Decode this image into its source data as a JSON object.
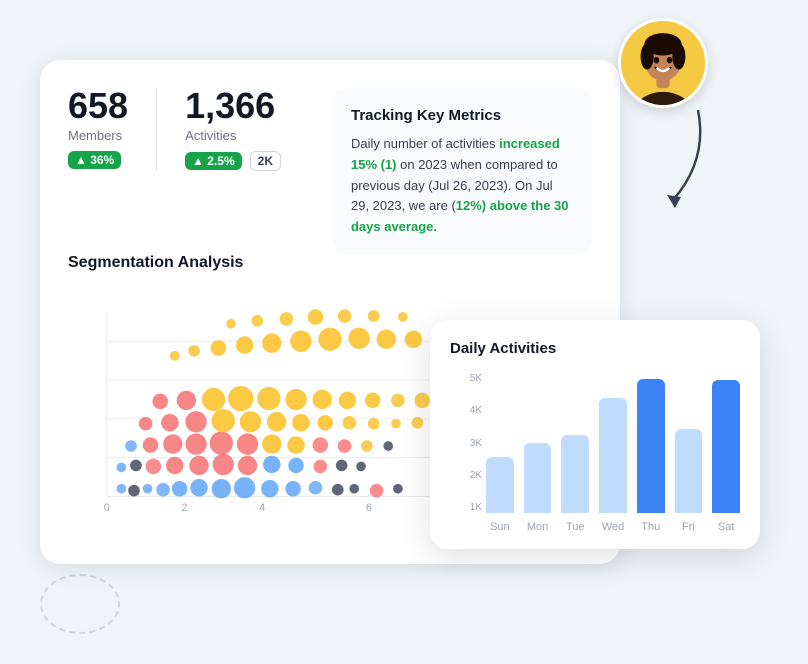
{
  "metrics": {
    "members": {
      "value": "658",
      "label": "Members",
      "badge": "▲ 36%"
    },
    "activities": {
      "value": "1,366",
      "label": "Activities",
      "badge": "▲ 2.5%",
      "badge2": "2K"
    }
  },
  "tracking": {
    "title": "Tracking Key Metrics",
    "text1": "Daily number of activities ",
    "highlight1": "increased 15% (1)",
    "text2": " on 2023 when compared to previous day (Jul 26, 2023). On Jul 29, 2023, we are (",
    "highlight2": "12%) above the 30 days average.",
    "text3": ""
  },
  "segmentation": {
    "title": "Segmentation Analysis"
  },
  "daily": {
    "title": "Daily Activities",
    "yLabels": [
      "5K",
      "4K",
      "3K",
      "2K",
      "1K"
    ],
    "bars": [
      {
        "day": "Sun",
        "value": 2000,
        "maxValue": 5000,
        "highlighted": false
      },
      {
        "day": "Mon",
        "value": 2500,
        "maxValue": 5000,
        "highlighted": false
      },
      {
        "day": "Tue",
        "value": 2800,
        "maxValue": 5000,
        "highlighted": false
      },
      {
        "day": "Wed",
        "value": 4100,
        "maxValue": 5000,
        "highlighted": false
      },
      {
        "day": "Thu",
        "value": 4800,
        "maxValue": 5000,
        "highlighted": true
      },
      {
        "day": "Fri",
        "value": 3000,
        "maxValue": 5000,
        "highlighted": false
      },
      {
        "day": "Sat",
        "value": 4750,
        "maxValue": 5000,
        "highlighted": true
      }
    ]
  }
}
